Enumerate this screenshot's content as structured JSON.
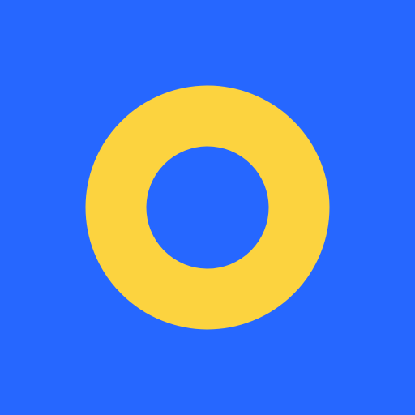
{
  "icon": {
    "name": "ring-icon",
    "background_color": "#2667FF",
    "ring_color": "#FCD33F"
  }
}
